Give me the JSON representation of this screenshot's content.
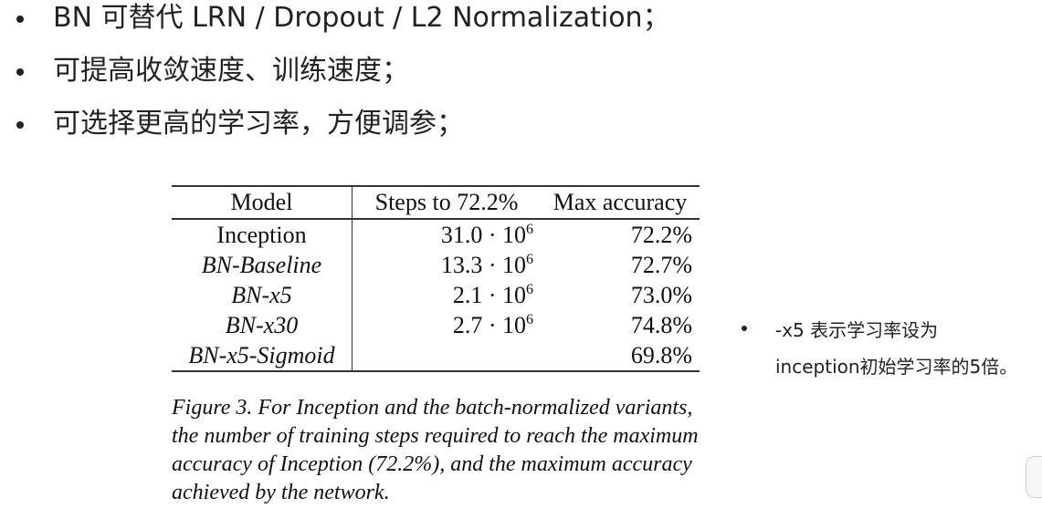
{
  "bullets": [
    "BN 可替代 LRN / Dropout / L2 Normalization；",
    "可提高收敛速度、训练速度；",
    "可选择更高的学习率，方便调参；"
  ],
  "table": {
    "headers": [
      "Model",
      "Steps to 72.2%",
      "Max accuracy"
    ],
    "rows": [
      {
        "model": "Inception",
        "steps_mantissa": "31.0 · 10",
        "steps_exp": "6",
        "accuracy": "72.2%"
      },
      {
        "model": "BN-Baseline",
        "steps_mantissa": "13.3 · 10",
        "steps_exp": "6",
        "accuracy": "72.7%"
      },
      {
        "model": "BN-x5",
        "steps_mantissa": "2.1 · 10",
        "steps_exp": "6",
        "accuracy": "73.0%"
      },
      {
        "model": "BN-x30",
        "steps_mantissa": "2.7 · 10",
        "steps_exp": "6",
        "accuracy": "74.8%"
      },
      {
        "model": "BN-x5-Sigmoid",
        "steps_mantissa": "",
        "steps_exp": "",
        "accuracy": "69.8%"
      }
    ]
  },
  "caption": {
    "lines": [
      "Figure 3. For Inception and the batch-normalized variants,",
      "the number of training steps required to reach the maximum",
      "accuracy of Inception (72.2%), and the maximum accuracy",
      "achieved by the network."
    ]
  },
  "note": {
    "line1": "-x5 表示学习率设为",
    "line2": "inception初始学习率的5倍。"
  }
}
